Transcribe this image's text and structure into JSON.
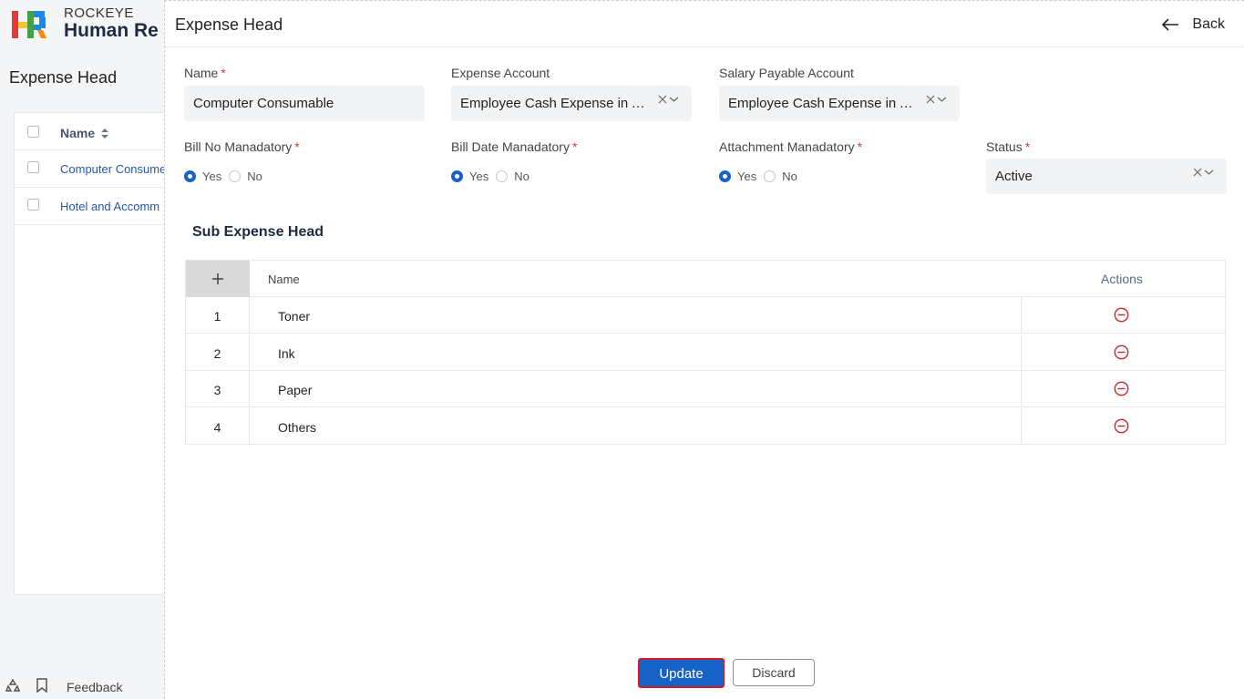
{
  "brand": {
    "top": "ROCKEYE",
    "bottom": "Human Re"
  },
  "background": {
    "page_title": "Expense Head",
    "table_header": "Name",
    "rows": [
      "Computer Consume",
      "Hotel and Accomm"
    ],
    "feedback_label": "Feedback"
  },
  "drawer": {
    "title": "Expense Head",
    "back_label": "Back",
    "fields": {
      "name": {
        "label": "Name",
        "value": "Computer Consumable"
      },
      "expense_account": {
        "label": "Expense Account",
        "value": "Employee Cash Expense in Adv..."
      },
      "salary_payable_account": {
        "label": "Salary Payable Account",
        "value": "Employee Cash Expense in Adv..."
      },
      "bill_no": {
        "label": "Bill No Manadatory",
        "yes": "Yes",
        "no": "No",
        "selected": "Yes"
      },
      "bill_date": {
        "label": "Bill Date Manadatory",
        "yes": "Yes",
        "no": "No",
        "selected": "Yes"
      },
      "attachment": {
        "label": "Attachment Manadatory",
        "yes": "Yes",
        "no": "No",
        "selected": "Yes"
      },
      "status": {
        "label": "Status",
        "value": "Active"
      }
    },
    "required_mark": "*",
    "sub_section": {
      "title": "Sub Expense Head",
      "col_name": "Name",
      "col_actions": "Actions",
      "rows": [
        {
          "index": "1",
          "name": "Toner"
        },
        {
          "index": "2",
          "name": "Ink"
        },
        {
          "index": "3",
          "name": "Paper"
        },
        {
          "index": "4",
          "name": "Others"
        }
      ]
    },
    "buttons": {
      "update": "Update",
      "discard": "Discard"
    }
  },
  "colors": {
    "primary": "#1762c6",
    "danger": "#c62828",
    "highlight_border": "#d71920"
  }
}
